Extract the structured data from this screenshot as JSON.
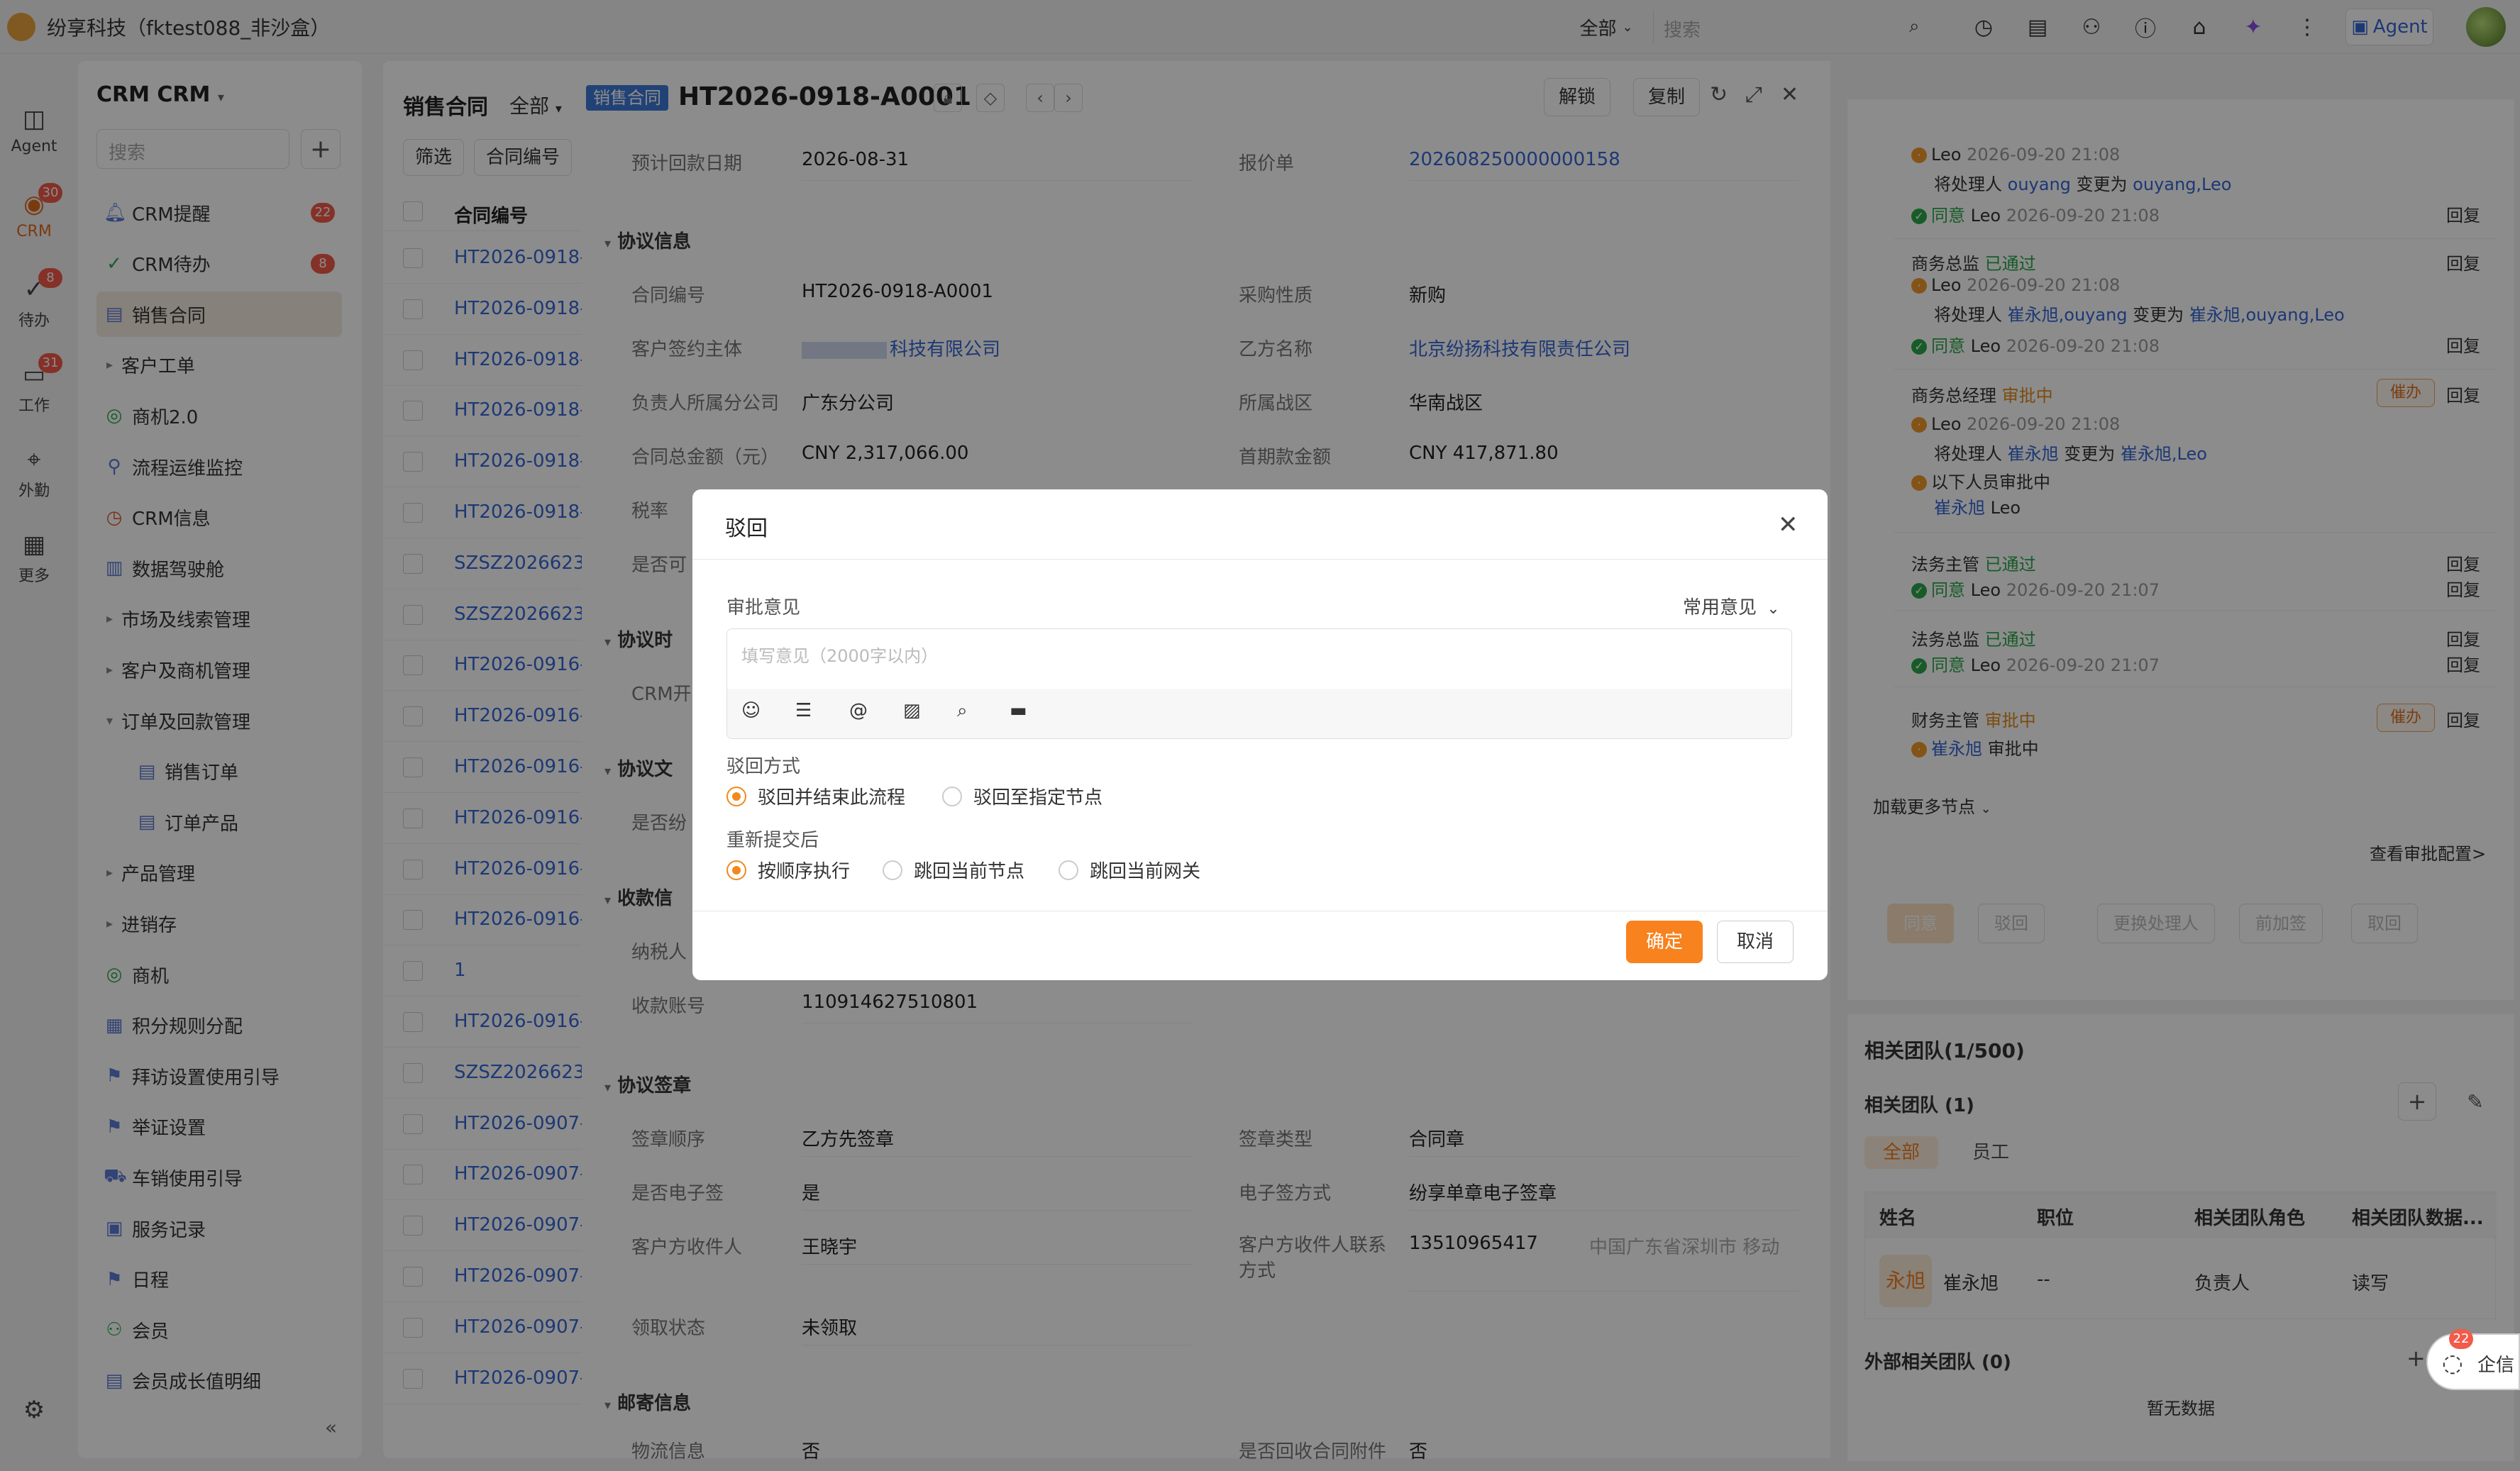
{
  "app": {
    "title": "纷享科技（fktest088_非沙盒）",
    "scope": "全部",
    "search_placeholder": "搜索",
    "agent_label": "Agent"
  },
  "rail": [
    {
      "label": "Agent",
      "icon": "agent-icon"
    },
    {
      "label": "CRM",
      "icon": "crm-icon",
      "badge": "30"
    },
    {
      "label": "待办",
      "icon": "todo-icon",
      "badge": "8"
    },
    {
      "label": "工作",
      "icon": "work-icon",
      "badge": "31"
    },
    {
      "label": "外勤",
      "icon": "field-icon"
    },
    {
      "label": "更多",
      "icon": "more-icon"
    }
  ],
  "nav": {
    "title": "CRM CRM",
    "search_placeholder": "搜索",
    "items": [
      {
        "label": "CRM提醒",
        "badge": "22"
      },
      {
        "label": "CRM待办",
        "badge": "8"
      },
      {
        "label": "销售合同"
      },
      {
        "label": "客户工单"
      },
      {
        "label": "商机2.0"
      },
      {
        "label": "流程运维监控"
      },
      {
        "label": "CRM信息"
      },
      {
        "label": "数据驾驶舱"
      },
      {
        "label": "市场及线索管理"
      },
      {
        "label": "客户及商机管理"
      },
      {
        "label": "订单及回款管理"
      },
      {
        "label": "销售订单"
      },
      {
        "label": "订单产品"
      },
      {
        "label": "产品管理"
      },
      {
        "label": "进销存"
      },
      {
        "label": "商机"
      },
      {
        "label": "积分规则分配"
      },
      {
        "label": "拜访设置使用引导"
      },
      {
        "label": "举证设置"
      },
      {
        "label": "车销使用引导"
      },
      {
        "label": "服务记录"
      },
      {
        "label": "日程"
      },
      {
        "label": "会员"
      },
      {
        "label": "会员成长值明细"
      }
    ]
  },
  "list": {
    "title": "销售合同",
    "scope": "全部",
    "filter_label": "筛选",
    "sort_label": "合同编号",
    "column": "合同编号",
    "rows": [
      "HT2026-0918-",
      "HT2026-0918-",
      "HT2026-0918-",
      "HT2026-0918-",
      "HT2026-0918-",
      "HT2026-0918-",
      "SZSZ2026623",
      "SZSZ2026623",
      "HT2026-0916-",
      "HT2026-0916-",
      "HT2026-0916-",
      "HT2026-0916-",
      "HT2026-0916-",
      "HT2026-0916-",
      "1",
      "HT2026-0916-",
      "SZSZ2026623",
      "HT2026-0907-",
      "HT2026-0907-",
      "HT2026-0907-",
      "HT2026-0907-",
      "HT2026-0907-",
      "HT2026-0907-"
    ]
  },
  "detail": {
    "tag": "销售合同",
    "title": "HT2026-0918-A0001",
    "unlock_label": "解锁",
    "copy_label": "复制",
    "fields": {
      "expected_date_label": "预计回款日期",
      "expected_date": "2026-08-31",
      "quote_label": "报价单",
      "quote": "202608250000000158",
      "sec_agreement": "协议信息",
      "contract_no_label": "合同编号",
      "contract_no": "HT2026-0918-A0001",
      "purchase_label": "采购性质",
      "purchase": "新购",
      "customer_label": "客户签约主体",
      "customer": "科技有限公司",
      "partyb_label": "乙方名称",
      "partyb": "北京纷扬科技有限责任公司",
      "branch_label": "负责人所属分公司",
      "branch": "广东分公司",
      "region_label": "所属战区",
      "region": "华南战区",
      "amount_label": "合同总金额（元）",
      "amount": "CNY 2,317,066.00",
      "first_label": "首期款金额",
      "first": "CNY 417,871.80",
      "tax_label": "税率",
      "avail_label": "是否可",
      "sec_time": "协议时",
      "crm_label": "CRM开",
      "sec_doc": "协议文",
      "doc_label": "是否纷",
      "sec_recv": "收款信",
      "taxpayer_label": "纳税人",
      "account_label": "收款账号",
      "account": "110914627510801",
      "sec_seal": "协议签章",
      "seal_order_label": "签章顺序",
      "seal_order": "乙方先签章",
      "seal_type_label": "签章类型",
      "seal_type": "合同章",
      "esign_label": "是否电子签",
      "esign": "是",
      "esign_way_label": "电子签方式",
      "esign_way": "纷享单章电子签章",
      "receiver_label": "客户方收件人",
      "receiver": "王晓宇",
      "receiver_phone_label": "客户方收件人联系方式",
      "receiver_phone": "13510965417",
      "phone_loc": "中国广东省深圳市 移动",
      "claim_label": "领取状态",
      "claim": "未领取",
      "sec_mail": "邮寄信息",
      "logistics_label": "物流信息",
      "logistics": "否",
      "recover_label": "是否回收合同附件",
      "recover": "否"
    }
  },
  "approval": {
    "entries": [
      {
        "role": "",
        "status": "",
        "who": "Leo",
        "time": "2026-09-20 21:08",
        "change_from": "ouyang",
        "change_to": "ouyang,Leo"
      },
      {
        "result": "同意",
        "who": "Leo",
        "time": "2026-09-20 21:08"
      },
      {
        "role": "商务总监",
        "status": "已通过",
        "who": "Leo",
        "time": "2026-09-20 21:08",
        "change_from": "崔永旭,ouyang",
        "change_to": "崔永旭,ouyang,Leo",
        "result": "同意",
        "result_time": "2026-09-20 21:08"
      },
      {
        "role": "商务总经理",
        "status": "审批中",
        "who": "Leo",
        "time": "2026-09-20 21:08",
        "change_from": "崔永旭",
        "change_to": "崔永旭,Leo",
        "pending_text": "以下人员审批中",
        "pending_users": "崔永旭",
        "pending_users2": "Leo"
      },
      {
        "role": "法务主管",
        "status": "已通过",
        "result": "同意",
        "who": "Leo",
        "time": "2026-09-20 21:07"
      },
      {
        "role": "法务总监",
        "status": "已通过",
        "result": "同意",
        "who": "Leo",
        "time": "2026-09-20 21:07"
      },
      {
        "role": "财务主管",
        "status": "审批中",
        "pending_users": "崔永旭",
        "pending_text": "审批中"
      }
    ],
    "handler_text": "将处理人",
    "change_text": "变更为",
    "reply": "回复",
    "urge": "催办",
    "load_more": "加载更多节点",
    "view_config": "查看审批配置>",
    "buttons": [
      "同意",
      "驳回",
      "更换处理人",
      "前加签",
      "取回"
    ]
  },
  "team": {
    "title": "相关团队(1/500)",
    "sub": "相关团队 (1)",
    "tabs": [
      "全部",
      "员工"
    ],
    "columns": [
      "姓名",
      "职位",
      "相关团队角色",
      "相关团队数据..."
    ],
    "row": {
      "avatar": "永旭",
      "name": "崔永旭",
      "position": "--",
      "role": "负责人",
      "perm": "读写"
    },
    "external": "外部相关团队 (0)",
    "empty": "暂无数据"
  },
  "qixin": {
    "label": "企信",
    "badge": "22"
  },
  "dialog": {
    "title": "驳回",
    "opinion_label": "审批意见",
    "common_label": "常用意见",
    "placeholder": "填写意见（2000字以内）",
    "method_label": "驳回方式",
    "method_options": [
      "驳回并结束此流程",
      "驳回至指定节点"
    ],
    "resubmit_label": "重新提交后",
    "resubmit_options": [
      "按顺序执行",
      "跳回当前节点",
      "跳回当前网关"
    ],
    "confirm": "确定",
    "cancel": "取消"
  }
}
